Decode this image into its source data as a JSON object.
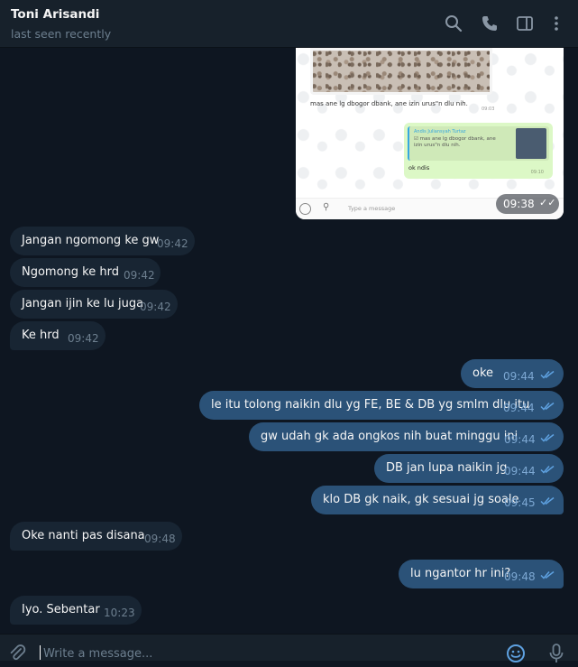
{
  "header": {
    "name": "Toni Arisandi",
    "status": "last seen recently",
    "icons": [
      "search-icon",
      "phone-icon",
      "sidebar-toggle-icon",
      "more-vertical-icon"
    ]
  },
  "image_card": {
    "caption": "mas ane lg dbogor dbank, ane izin urus\"n dlu nih.",
    "caption_time": "09:03",
    "reply_author": "Andis Juliansyah Turtaz",
    "reply_quote": "☑ mas ane lg dbogor dbank, ane izin urus\"n dlu nih.",
    "reply_text": "ok ndis",
    "reply_time": "09:10",
    "mini_input_placeholder": "Type a message",
    "time": "09:38"
  },
  "messages": [
    {
      "dir": "in",
      "text": "Jangan ngomong ke gw",
      "time": "09:42"
    },
    {
      "dir": "in",
      "text": "Ngomong ke hrd",
      "time": "09:42"
    },
    {
      "dir": "in",
      "text": "Jangan ijin ke lu juga",
      "time": "09:42"
    },
    {
      "dir": "in",
      "text": "Ke hrd",
      "time": "09:42"
    },
    {
      "dir": "out",
      "text": "oke",
      "time": "09:44"
    },
    {
      "dir": "out",
      "text": "le itu tolong naikin dlu yg FE, BE & DB yg smlm dlu itu",
      "time": "09:44"
    },
    {
      "dir": "out",
      "text": "gw udah gk ada ongkos nih buat minggu ini",
      "time": "09:44"
    },
    {
      "dir": "out",
      "text": "DB jan lupa naikin jg",
      "time": "09:44"
    },
    {
      "dir": "out",
      "text": "klo DB gk naik, gk sesuai jg soale",
      "time": "09:45"
    },
    {
      "dir": "in",
      "text": "Oke nanti pas disana",
      "time": "09:48"
    },
    {
      "dir": "out",
      "text": "lu ngantor hr ini?",
      "time": "09:48"
    },
    {
      "dir": "in",
      "text": "Iyo. Sebentar",
      "time": "10:23"
    }
  ],
  "composer": {
    "placeholder": "Write a message...",
    "icons": [
      "attach-icon",
      "emoji-icon",
      "microphone-icon"
    ]
  },
  "colors": {
    "background": "#0e1621",
    "header": "#17212b",
    "incoming_bubble": "#182533",
    "outgoing_bubble": "#2b5278",
    "time_in": "#6d7f8f",
    "time_out": "#7da8d3"
  }
}
